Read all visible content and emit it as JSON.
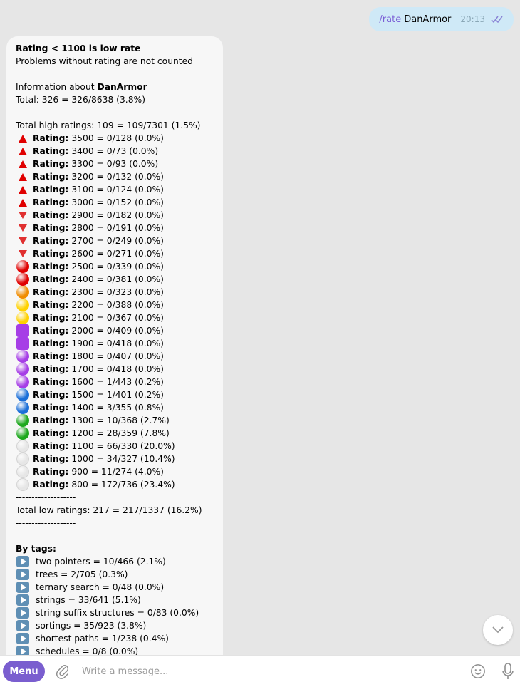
{
  "outgoing": {
    "command": "/rate",
    "argument": "DanArmor",
    "time": "20:13"
  },
  "incoming": {
    "header_bold": "Rating < 1100 is low rate",
    "note": "Problems without rating are not counted",
    "info_prefix": "Information about ",
    "info_user": "DanArmor",
    "total": "Total: 326 = 326/8638 (3.8%)",
    "separator": "-------------------",
    "total_high": "Total high ratings: 109 = 109/7301 (1.5%)",
    "rating_label": "Rating:",
    "ratings": [
      {
        "icon": "red-triangle-up-icon",
        "value": "3500 = 0/128 (0.0%)"
      },
      {
        "icon": "red-triangle-up-icon",
        "value": "3400 = 0/73 (0.0%)"
      },
      {
        "icon": "red-triangle-up-icon",
        "value": "3300 = 0/93 (0.0%)"
      },
      {
        "icon": "red-triangle-up-icon",
        "value": "3200 = 0/132 (0.0%)"
      },
      {
        "icon": "red-triangle-up-icon",
        "value": "3100 = 0/124 (0.0%)"
      },
      {
        "icon": "red-triangle-up-icon",
        "value": "3000 = 0/152 (0.0%)"
      },
      {
        "icon": "red-triangle-down-icon",
        "value": "2900 = 0/182 (0.0%)"
      },
      {
        "icon": "red-triangle-down-icon",
        "value": "2800 = 0/191 (0.0%)"
      },
      {
        "icon": "red-triangle-down-icon",
        "value": "2700 = 0/249 (0.0%)"
      },
      {
        "icon": "red-triangle-down-icon",
        "value": "2600 = 0/271 (0.0%)"
      },
      {
        "icon": "red-circle-icon",
        "value": "2500 = 0/339 (0.0%)"
      },
      {
        "icon": "red-circle-icon",
        "value": "2400 = 0/381 (0.0%)"
      },
      {
        "icon": "orange-circle-icon",
        "value": "2300 = 0/323 (0.0%)"
      },
      {
        "icon": "yellow-circle-icon",
        "value": "2200 = 0/388 (0.0%)"
      },
      {
        "icon": "yellow-circle-icon",
        "value": "2100 = 0/367 (0.0%)"
      },
      {
        "icon": "purple-square-icon",
        "value": "2000 = 0/409 (0.0%)"
      },
      {
        "icon": "purple-square-icon",
        "value": "1900 = 0/418 (0.0%)"
      },
      {
        "icon": "purple-circle-icon",
        "value": "1800 = 0/407 (0.0%)"
      },
      {
        "icon": "purple-circle-icon",
        "value": "1700 = 0/418 (0.0%)"
      },
      {
        "icon": "purple-circle-icon",
        "value": "1600 = 1/443 (0.2%)"
      },
      {
        "icon": "blue-circle-icon",
        "value": "1500 = 1/401 (0.2%)"
      },
      {
        "icon": "blue-circle-icon",
        "value": "1400 = 3/355 (0.8%)"
      },
      {
        "icon": "green-circle-icon",
        "value": "1300 = 10/368 (2.7%)"
      },
      {
        "icon": "green-circle-icon",
        "value": "1200 = 28/359 (7.8%)"
      },
      {
        "icon": "white-circle-icon",
        "value": "1100 = 66/330 (20.0%)"
      },
      {
        "icon": "white-circle-icon",
        "value": "1000 = 34/327 (10.4%)"
      },
      {
        "icon": "white-circle-icon",
        "value": "900 = 11/274 (4.0%)"
      },
      {
        "icon": "white-circle-icon",
        "value": "800 = 172/736 (23.4%)"
      }
    ],
    "total_low": "Total low ratings: 217 = 217/1337 (16.2%)",
    "by_tags": "By tags:",
    "tags": [
      "two pointers = 10/466 (2.1%)",
      "trees = 2/705 (0.3%)",
      "ternary search = 0/48 (0.0%)",
      "strings = 33/641 (5.1%)",
      "string suffix structures = 0/83 (0.0%)",
      "sortings = 35/923 (3.8%)",
      "shortest paths = 1/238 (0.4%)",
      "schedules = 0/8 (0.0%)"
    ]
  },
  "composer": {
    "menu_label": "Menu",
    "placeholder": "Write a message..."
  },
  "colors": {
    "accent": "#7a5ecf",
    "red": "#e00000",
    "orange": "#f08c00",
    "yellow": "#ffd200",
    "purple": "#a63ee6",
    "blue": "#1b6fd8",
    "green": "#1ea81e",
    "white_circle": "#e6e6e6",
    "play": "#5f8fb4"
  }
}
